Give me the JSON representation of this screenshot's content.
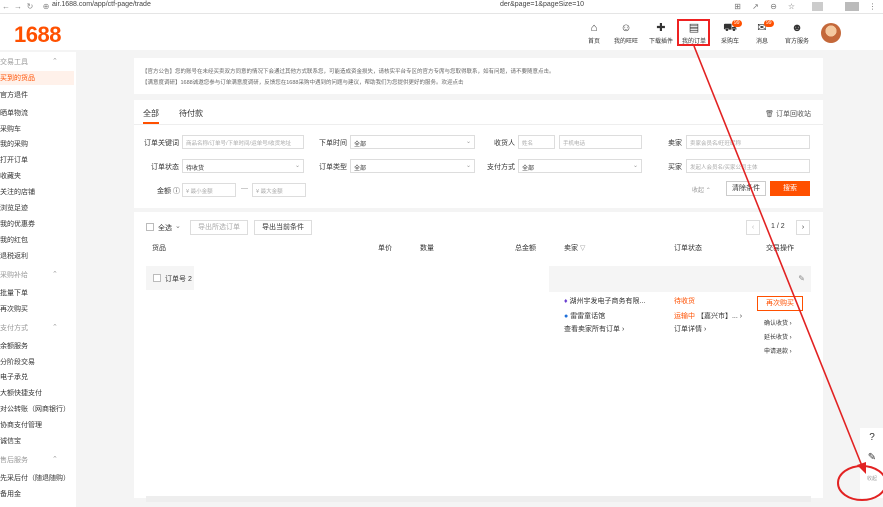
{
  "browser": {
    "url_left": "air.1688.com/app/ctf-page/trade",
    "url_right": "der&page=1&pageSize=10"
  },
  "header": {
    "logo": "1688",
    "nav": [
      {
        "label": "首页",
        "icon": "home-icon",
        "glyph": "⌂"
      },
      {
        "label": "我的旺旺",
        "icon": "chat-icon",
        "glyph": "☺"
      },
      {
        "label": "下载插件",
        "icon": "plugin-icon",
        "glyph": "✚"
      },
      {
        "label": "我的订单",
        "icon": "orders-icon",
        "glyph": "▤"
      },
      {
        "label": "采购车",
        "icon": "cart-icon",
        "glyph": "⛟",
        "badge": "99"
      },
      {
        "label": "消息",
        "icon": "message-icon",
        "glyph": "✉",
        "badge": "99"
      },
      {
        "label": "官方服务",
        "icon": "user-icon",
        "glyph": "☻"
      }
    ]
  },
  "sidebar": {
    "items": [
      {
        "label": "交易工具",
        "group": true
      },
      {
        "label": "买到的货品",
        "active": true
      },
      {
        "label": "官方退件"
      },
      {
        "label": "晒单物流"
      },
      {
        "label": "采购车"
      },
      {
        "label": "我的采购"
      },
      {
        "label": "打开订单"
      },
      {
        "label": "收藏夹"
      },
      {
        "label": "关注的店铺"
      },
      {
        "label": "浏览足迹"
      },
      {
        "label": "我的优惠券"
      },
      {
        "label": "我的红包"
      },
      {
        "label": "退税返利"
      },
      {
        "label": "采购补给",
        "group": true
      },
      {
        "label": "批量下单"
      },
      {
        "label": "再次购买"
      },
      {
        "label": "支付方式",
        "group": true
      },
      {
        "label": "余额服务"
      },
      {
        "label": "分阶段交易"
      },
      {
        "label": "电子承兑"
      },
      {
        "label": "大额快捷支付"
      },
      {
        "label": "对公转账（网商银行）"
      },
      {
        "label": "协商支付管理"
      },
      {
        "label": "诚信宝"
      },
      {
        "label": "售后服务",
        "group": true
      },
      {
        "label": "先采后付（随退随购）"
      },
      {
        "label": "备用金"
      }
    ]
  },
  "notice": {
    "line1": "【官方公告】您的账号在未经买卖双方同意的情况下会通过其他方式联系您，可能造成资金损失，请核实平台专区的官方专席与您取得联系，如有问题，请不要随意点击。",
    "line2": "【满意度调研】1688诚邀您参与订单满意度调研，反馈您在1688采购中遇到的问题与建议，帮助我们为您提供更好的服务。欢迎点击"
  },
  "filters": {
    "tabs": [
      "全部",
      "待付款"
    ],
    "recycle": "订单回收站",
    "order_keyword_label": "订单关键词",
    "order_keyword_placeholder": "商品名称/订单号/下单时间/运单号/收货地址",
    "order_time_label": "下单时间",
    "order_time_value": "全部",
    "receiver_label": "收货人",
    "receiver_name_placeholder": "姓名",
    "receiver_phone_placeholder": "手机电话",
    "seller_label": "卖家",
    "seller_placeholder": "卖家会员名/旺旺昵称",
    "order_status_label": "订单状态",
    "order_status_value": "待收货",
    "order_type_label": "订单类型",
    "order_type_value": "全部",
    "pay_method_label": "支付方式",
    "pay_method_value": "全部",
    "buyer_label": "买家",
    "buyer_placeholder": "发起人会员名/买家公司主体",
    "amount_label": "金额",
    "amount_min_placeholder": "最小金额",
    "amount_sep": "—",
    "amount_max_placeholder": "最大金额",
    "collapse": "收起",
    "clear_button": "清除条件",
    "search_button": "搜索"
  },
  "orders": {
    "select_all": "全选",
    "export_selected": "导出所选订单",
    "export_current": "导出当前条件",
    "page_current": "1",
    "page_total": "2",
    "columns": [
      "货品",
      "单价",
      "数量",
      "总金额",
      "卖家",
      "订单状态",
      "交易操作"
    ],
    "order_no_label": "订单号",
    "order_no_value": "2",
    "seller_name": "湖州宇发电子商务有限...",
    "seller_chat": "雷雷童话馆",
    "seller_all_orders": "查看卖家所有订单",
    "status_main": "待收货",
    "status_shipping": "运输中",
    "status_location": "【嘉兴市】...",
    "order_detail": "订单详情",
    "rebuy": "再次购买",
    "actions": [
      "确认收货",
      "延长收货",
      "申请退款"
    ]
  },
  "tools": {
    "help_icon": "?",
    "edit_icon": "✎",
    "collapse_label": "收起"
  },
  "colors": {
    "accent": "#ff5000",
    "annotation": "#e22222",
    "link_blue": "#1e6fd9"
  }
}
